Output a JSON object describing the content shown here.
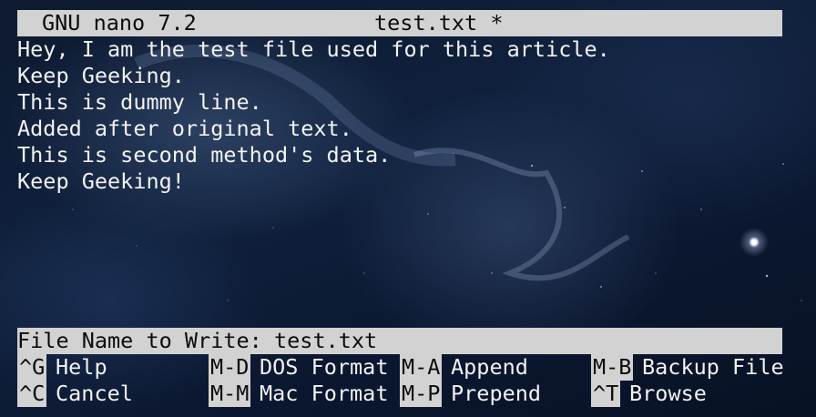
{
  "titlebar": {
    "app": "GNU nano 7.2",
    "filename": "test.txt *"
  },
  "editor": {
    "lines": [
      "Hey, I am the test file used for this article.",
      "Keep Geeking.",
      "This is dummy line.",
      "Added after original text.",
      "This is second method's data.",
      "Keep Geeking!"
    ]
  },
  "prompt": {
    "label": "File Name to Write: ",
    "value": "test.txt"
  },
  "shortcuts": {
    "row1": [
      {
        "key": "^G",
        "label": "Help"
      },
      {
        "key": "M-D",
        "label": "DOS Format"
      },
      {
        "key": "M-A",
        "label": "Append"
      },
      {
        "key": "M-B",
        "label": "Backup File"
      }
    ],
    "row2": [
      {
        "key": "^C",
        "label": "Cancel"
      },
      {
        "key": "M-M",
        "label": "Mac Format"
      },
      {
        "key": "M-P",
        "label": "Prepend"
      },
      {
        "key": "^T",
        "label": "Browse"
      }
    ]
  }
}
